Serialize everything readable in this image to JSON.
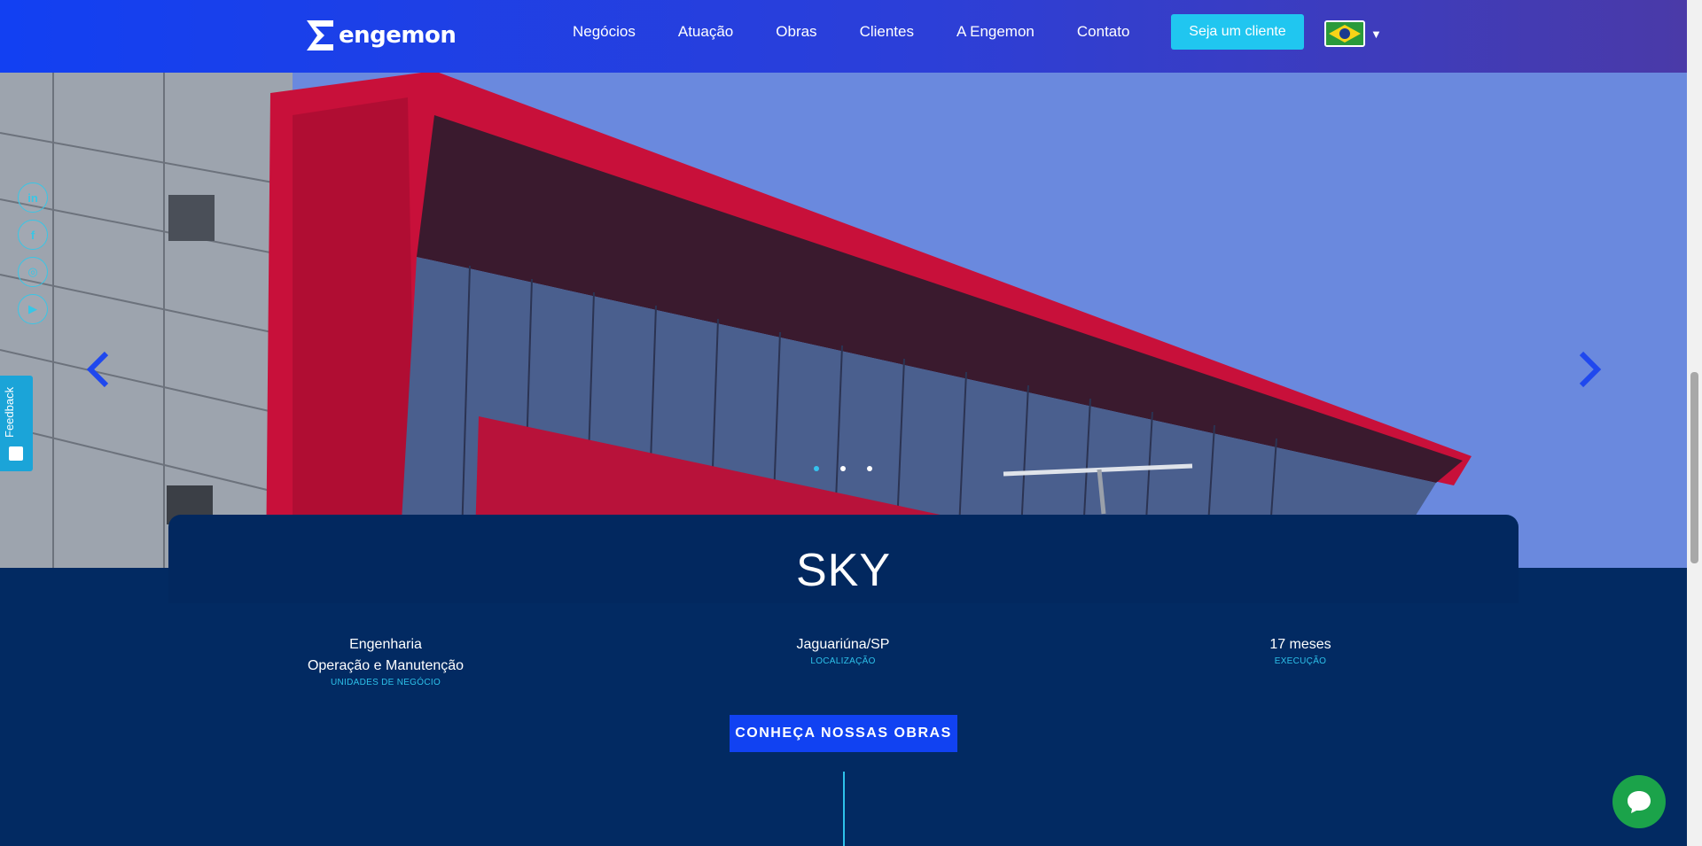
{
  "header": {
    "logo_text": "engemon",
    "nav": [
      {
        "label": "Negócios"
      },
      {
        "label": "Atuação"
      },
      {
        "label": "Obras"
      },
      {
        "label": "Clientes"
      },
      {
        "label": "A Engemon"
      },
      {
        "label": "Contato"
      }
    ],
    "cta_label": "Seja um cliente",
    "language_icon": "brazil-flag-icon"
  },
  "social": [
    {
      "icon": "linkedin-icon",
      "glyph": "in"
    },
    {
      "icon": "facebook-icon",
      "glyph": "f"
    },
    {
      "icon": "instagram-icon",
      "glyph": "◎"
    },
    {
      "icon": "youtube-icon",
      "glyph": "▶"
    }
  ],
  "feedback": {
    "label": "Feedback"
  },
  "slider": {
    "dots": 3,
    "active_dot": 0
  },
  "project": {
    "title": "SKY",
    "facts": [
      {
        "lines": [
          "Engenharia",
          "Operação e Manutenção"
        ],
        "label": "UNIDADES DE NEGÓCIO"
      },
      {
        "lines": [
          "Jaguariúna/SP"
        ],
        "label": "LOCALIZAÇÃO"
      },
      {
        "lines": [
          "17 meses"
        ],
        "label": "EXECUÇÃO"
      }
    ],
    "cta_label": "CONHEÇA NOSSAS OBRAS"
  },
  "colors": {
    "header_start": "#1240f2",
    "header_end": "#4a3aa8",
    "accent_cyan": "#20c6f0",
    "navy": "#02285f",
    "cta_blue": "#1142f2",
    "chat_green": "#1ba34a"
  }
}
